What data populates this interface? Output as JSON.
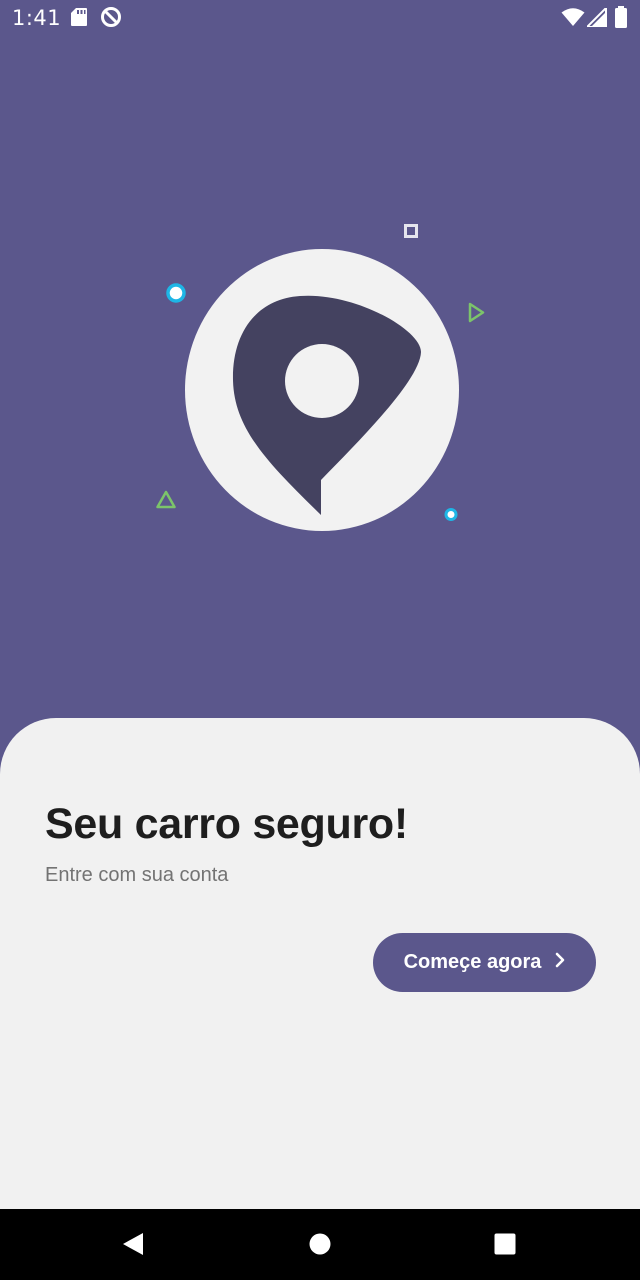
{
  "status_bar": {
    "time": "1:41",
    "icons": [
      "sd-card-icon",
      "do-not-disturb-icon",
      "wifi-icon",
      "cellular-signal-icon",
      "battery-icon"
    ]
  },
  "hero": {
    "illustration": "location-pin-icon",
    "decorations": [
      "square-outline",
      "ring-dot",
      "triangle-outline",
      "play-triangle-outline",
      "small-ring-dot"
    ]
  },
  "content": {
    "headline": "Seu carro seguro!",
    "subtitle": "Entre com sua conta",
    "cta_label": "Comeҫe agora",
    "cta_icon": "chevron-right-icon"
  },
  "nav_bar": {
    "buttons": [
      "back-icon",
      "home-icon",
      "recents-icon"
    ]
  },
  "colors": {
    "primary": "#5B578C",
    "pin": "#444260",
    "sheet": "#F1F1F1",
    "accent_cyan": "#1EB6E6",
    "accent_green": "#7CC46A"
  }
}
